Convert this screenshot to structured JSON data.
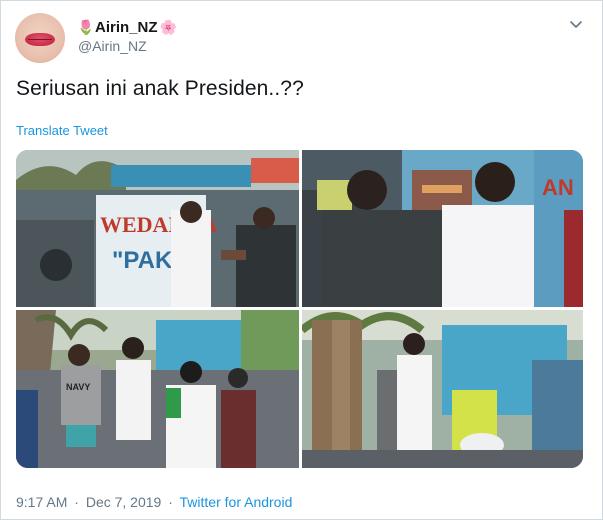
{
  "user": {
    "display_name": "Airin_NZ",
    "handle": "@Airin_NZ",
    "name_emoji_left": "🌷",
    "name_emoji_right": "🌸"
  },
  "tweet": {
    "text": "Seriusan ini anak Presiden..??",
    "translate_label": "Translate Tweet"
  },
  "media": {
    "photos": [
      {
        "sign_line1": "WEDANGA",
        "sign_line2": "\"PAK M"
      },
      {
        "sign_text": "AN"
      },
      {
        "shirt_text": "NAVY"
      },
      {}
    ]
  },
  "footer": {
    "time": "9:17 AM",
    "separator": "·",
    "date": "Dec 7, 2019",
    "source": "Twitter for Android"
  },
  "colors": {
    "link": "#1b95e0",
    "secondary_text": "#657786",
    "border": "#cfd9de"
  }
}
